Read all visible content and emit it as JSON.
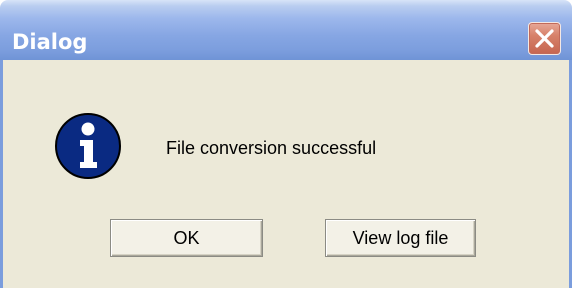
{
  "window": {
    "title": "Dialog",
    "close_icon": "close-icon"
  },
  "dialog": {
    "icon": "info-icon",
    "message": "File conversion successful",
    "ok_label": "OK",
    "view_log_label": "View log file"
  },
  "colors": {
    "titlebar": "#86a6e3",
    "client_background": "#ece9d8",
    "close_button": "#d7826a",
    "info_icon": "#0a2a82"
  }
}
